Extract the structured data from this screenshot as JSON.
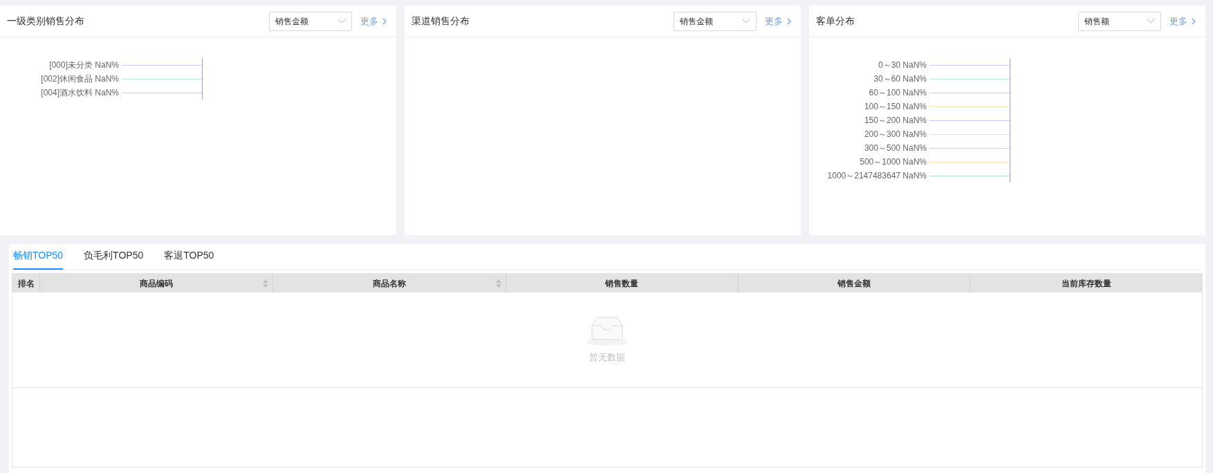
{
  "panels": [
    {
      "title": "一级类别销售分布",
      "select": {
        "value": "销售金额"
      },
      "more": "更多",
      "labels": [
        {
          "text": "[000]未分类 NaN%",
          "color": "#c6d6f5"
        },
        {
          "text": "[002]休闲食品 NaN%",
          "color": "#c2eadb"
        },
        {
          "text": "[004]酒水饮料 NaN%",
          "color": "#c4cad8"
        }
      ]
    },
    {
      "title": "渠道销售分布",
      "select": {
        "value": "销售金额"
      },
      "more": "更多"
    },
    {
      "title": "客单分布",
      "select": {
        "value": "销售额"
      },
      "more": "更多",
      "labels": [
        {
          "text": "0～30 NaN%",
          "color": "#c6d6f5"
        },
        {
          "text": "30～60 NaN%",
          "color": "#c2eadb"
        },
        {
          "text": "60～100 NaN%",
          "color": "#c4cad8"
        },
        {
          "text": "100～150 NaN%",
          "color": "#fae3b0"
        },
        {
          "text": "150～200 NaN%",
          "color": "#cfc6f5"
        },
        {
          "text": "200～300 NaN%",
          "color": "#cbe8f4"
        },
        {
          "text": "300～500 NaN%",
          "color": "#dccbea"
        },
        {
          "text": "500～1000 NaN%",
          "color": "#fcdcc2"
        },
        {
          "text": "1000～2147483647 NaN%",
          "color": "#a9dbdc"
        }
      ]
    }
  ],
  "tabs": [
    {
      "label": "畅销TOP50",
      "selected": true
    },
    {
      "label": "负毛利TOP50",
      "selected": false
    },
    {
      "label": "客退TOP50",
      "selected": false
    }
  ],
  "table": {
    "columns": [
      {
        "label": "排名",
        "sortable": false
      },
      {
        "label": "商品编码",
        "sortable": true
      },
      {
        "label": "商品名称",
        "sortable": true
      },
      {
        "label": "销售数量",
        "sortable": false
      },
      {
        "label": "销售金额",
        "sortable": false
      },
      {
        "label": "当前库存数量",
        "sortable": false
      }
    ],
    "empty_text": "暂无数据"
  }
}
